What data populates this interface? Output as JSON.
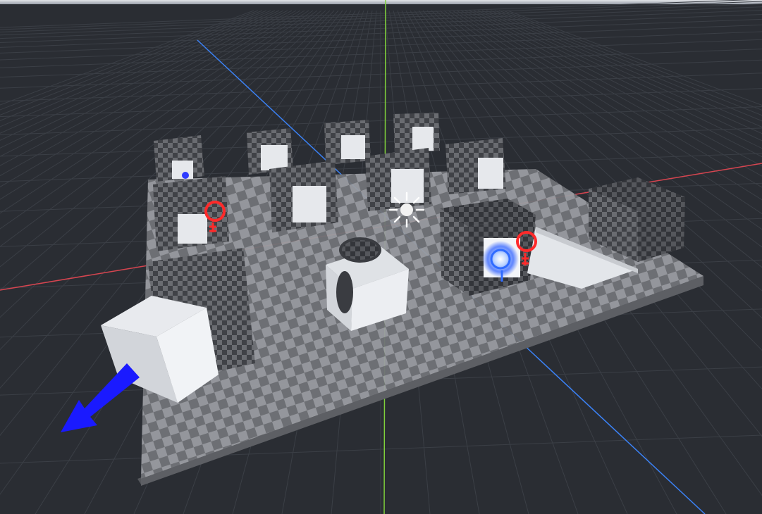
{
  "viewport": {
    "kind": "3d-editor-viewport",
    "background_color": "#2a2d33",
    "grid_line_color": "#3b3f46",
    "axes": {
      "x_axis_color": "#d64550",
      "y_axis_color": "#7fd13b",
      "z_axis_color": "#3b82f6"
    }
  },
  "scene": {
    "floor": {
      "light_tile": "#9a9ca1",
      "dark_tile": "#6f7176",
      "edge": "#55575c"
    },
    "checker_cube_colors": {
      "light": "#6a6c71",
      "dark": "#3f4146",
      "panel": "#e6e8ec"
    },
    "white_cube_color": "#e9ebef",
    "gizmos": {
      "directional_light": "sun-icon",
      "omni_lights": [
        {
          "icon": "lightbulb-icon",
          "color": "#ff2a2a"
        },
        {
          "icon": "lightbulb-icon",
          "color": "#ff2a2a"
        },
        {
          "icon": "lightbulb-icon",
          "color": "#2f6bff"
        },
        {
          "icon": "lightbulb-icon",
          "color": "#2f6bff"
        }
      ],
      "spot_direction_arrow": {
        "icon": "arrow-icon",
        "color": "#1a1aff"
      }
    }
  }
}
